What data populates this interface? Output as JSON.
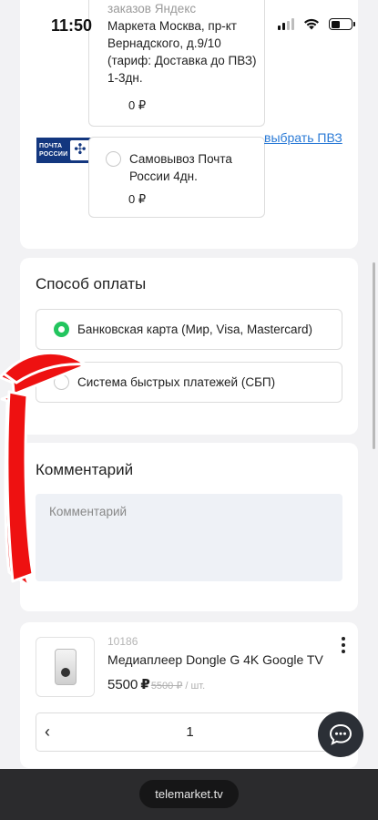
{
  "status_bar": {
    "time": "11:50"
  },
  "delivery": {
    "pvz_yandex": {
      "text_faded": "заказов Яндекс",
      "text": "Маркета Москва, пр-кт Вернадского, д.9/10 (тариф: Доставка до ПВЗ) 1-3дн.",
      "price": "0 ₽"
    },
    "pvz_pochta": {
      "text": "Самовывоз Почта России 4дн.",
      "price": "0 ₽",
      "logo_text_line1": "ПОЧТА",
      "logo_text_line2": "РОССИИ"
    },
    "choose_pvz_link": "выбрать ПВЗ"
  },
  "payment": {
    "heading": "Способ оплаты",
    "options": [
      {
        "label": "Банковская карта (Мир, Visa, Mastercard)",
        "selected": true
      },
      {
        "label": "Система быстрых платежей (СБП)",
        "selected": false
      }
    ]
  },
  "comment": {
    "heading": "Комментарий",
    "placeholder": "Комментарий"
  },
  "product": {
    "sku": "10186",
    "name": "Медиаплеер Dongle G 4K Google TV",
    "price": "5500",
    "currency": "₽",
    "old_price": "5500 ₽",
    "unit": "/ шт.",
    "quantity": "1",
    "decrement": "‹"
  },
  "browser": {
    "url": "telemarket.tv"
  },
  "colors": {
    "accent_green": "#22c55e",
    "link_blue": "#2a7ad6",
    "arrow_red": "#ee1111",
    "pochta_blue": "#13377f"
  }
}
